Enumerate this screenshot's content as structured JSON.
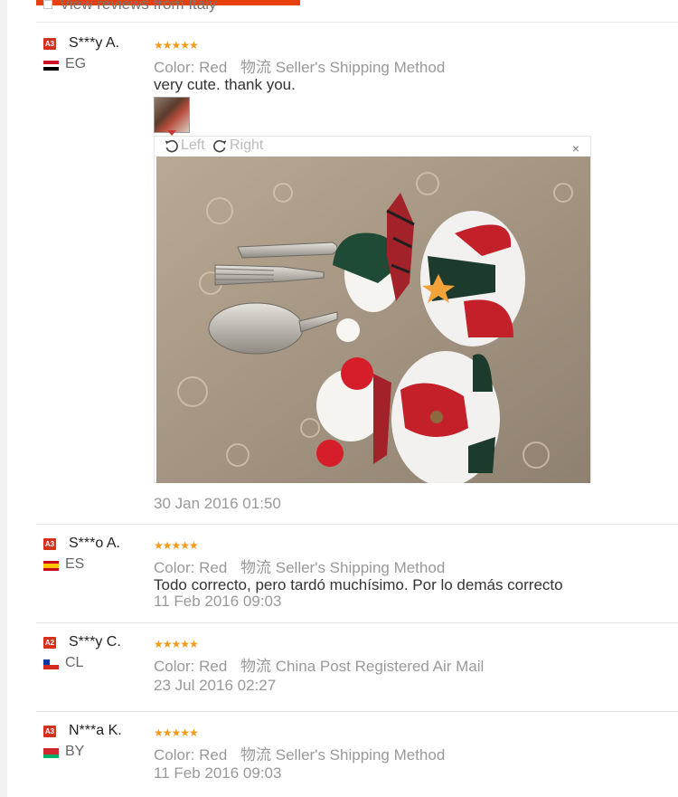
{
  "filter": {
    "label": "View reviews from Italy"
  },
  "reviews": [
    {
      "level": "A3",
      "user": "S***y A.",
      "country": "EG",
      "color_label": "Color:",
      "color": "Red",
      "logistics_label": "物流",
      "shipping": "Seller's Shipping Method",
      "text": "very cute. thank you.",
      "date": "30 Jan 2016 01:50"
    },
    {
      "level": "A3",
      "user": "S***o A.",
      "country": "ES",
      "color_label": "Color:",
      "color": "Red",
      "logistics_label": "物流",
      "shipping": "Seller's Shipping Method",
      "text": "Todo correcto, pero tardó muchísimo. Por lo demás correcto",
      "date": "11 Feb 2016 09:03"
    },
    {
      "level": "A2",
      "user": "S***y C.",
      "country": "CL",
      "color_label": "Color:",
      "color": "Red",
      "logistics_label": "物流",
      "shipping": "China Post Registered Air Mail",
      "date": "23 Jul 2016 02:27"
    },
    {
      "level": "A3",
      "user": "N***a K.",
      "country": "BY",
      "color_label": "Color:",
      "color": "Red",
      "logistics_label": "物流",
      "shipping": "Seller's Shipping Method",
      "date": "11 Feb 2016 09:03"
    }
  ],
  "stars": "★★★★★",
  "rating": 5,
  "viewer": {
    "rotate_left": "Left",
    "rotate_right": "Right",
    "close": "×"
  },
  "colors": {
    "accent": "#e8400c",
    "star": "#f29b1b",
    "badge": "#d5311d"
  }
}
